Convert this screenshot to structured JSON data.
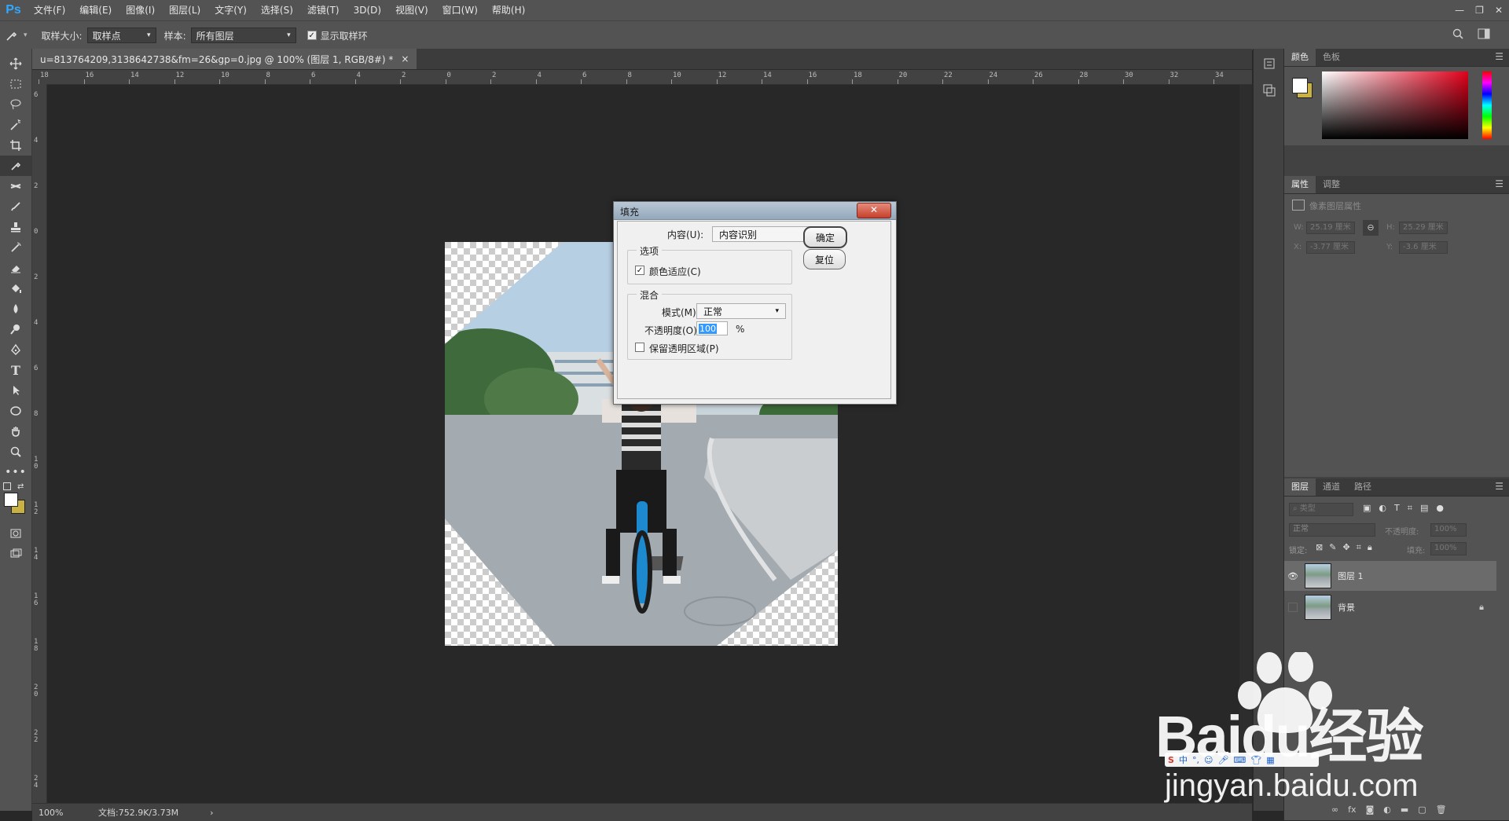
{
  "app": {
    "logo": "Ps"
  },
  "menu": [
    "文件(F)",
    "编辑(E)",
    "图像(I)",
    "图层(L)",
    "文字(Y)",
    "选择(S)",
    "滤镜(T)",
    "3D(D)",
    "视图(V)",
    "窗口(W)",
    "帮助(H)"
  ],
  "window_controls": {
    "minimize": "—",
    "restore": "❐",
    "close": "✕"
  },
  "options": {
    "sample_size_label": "取样大小:",
    "sample_size_value": "取样点",
    "sample_label": "样本:",
    "sample_value": "所有图层",
    "show_ring_label": "显示取样环",
    "show_ring_checked": true
  },
  "document": {
    "tab_title": "u=813764209,3138642738&fm=26&gp=0.jpg @ 100% (图层 1, RGB/8#) *",
    "tab_close": "×"
  },
  "ruler_h": [
    "18",
    "16",
    "14",
    "12",
    "10",
    "8",
    "6",
    "4",
    "2",
    "0",
    "2",
    "4",
    "6",
    "8",
    "10",
    "12",
    "14",
    "16",
    "18",
    "20",
    "22",
    "24",
    "26",
    "28",
    "30",
    "32",
    "34"
  ],
  "ruler_v": [
    "6",
    "4",
    "2",
    "0",
    "2",
    "4",
    "6",
    "8",
    "1 0",
    "1 2",
    "1 4",
    "1 6",
    "1 8",
    "2 0",
    "2 2",
    "2 4"
  ],
  "status": {
    "zoom": "100%",
    "doc_info": "文档:752.9K/3.73M",
    "arrow": "›"
  },
  "fill_dialog": {
    "title": "填充",
    "close": "✕",
    "content_label": "内容(U):",
    "content_value": "内容识别",
    "options_group": "选项",
    "color_adapt_label": "颜色适应(C)",
    "color_adapt_checked": true,
    "blend_group": "混合",
    "mode_label": "模式(M):",
    "mode_value": "正常",
    "opacity_label": "不透明度(O):",
    "opacity_value": "100",
    "opacity_unit": "%",
    "preserve_label": "保留透明区域(P)",
    "preserve_checked": false,
    "ok_button": "确定",
    "reset_button": "复位"
  },
  "panels": {
    "color_tabs": [
      "颜色",
      "色板"
    ],
    "props_tabs": [
      "属性",
      "调整"
    ],
    "props_title": "像素图层属性",
    "props": {
      "w_label": "W:",
      "w_value": "25.19 厘米",
      "h_label": "H:",
      "h_value": "25.29 厘米",
      "x_label": "X:",
      "x_value": "-3.77 厘米",
      "y_label": "Y:",
      "y_value": "-3.6 厘米"
    },
    "layers_tabs": [
      "图层",
      "通道",
      "路径"
    ],
    "layers": {
      "filter_placeholder": "类型",
      "blend_mode": "正常",
      "opacity_label": "不透明度:",
      "opacity_value": "100%",
      "lock_label": "锁定:",
      "fill_label": "填充:",
      "fill_value": "100%",
      "items": [
        {
          "name": "图层 1",
          "visible": true,
          "selected": true
        },
        {
          "name": "背景",
          "visible": false,
          "locked": true
        }
      ]
    }
  },
  "watermark": {
    "brand": "Baidu经验",
    "url": "jingyan.baidu.com"
  },
  "colors": {
    "chrome": "#535353",
    "canvas": "#282828",
    "accent": "#31a8ff",
    "watermark": "#ffffff"
  }
}
